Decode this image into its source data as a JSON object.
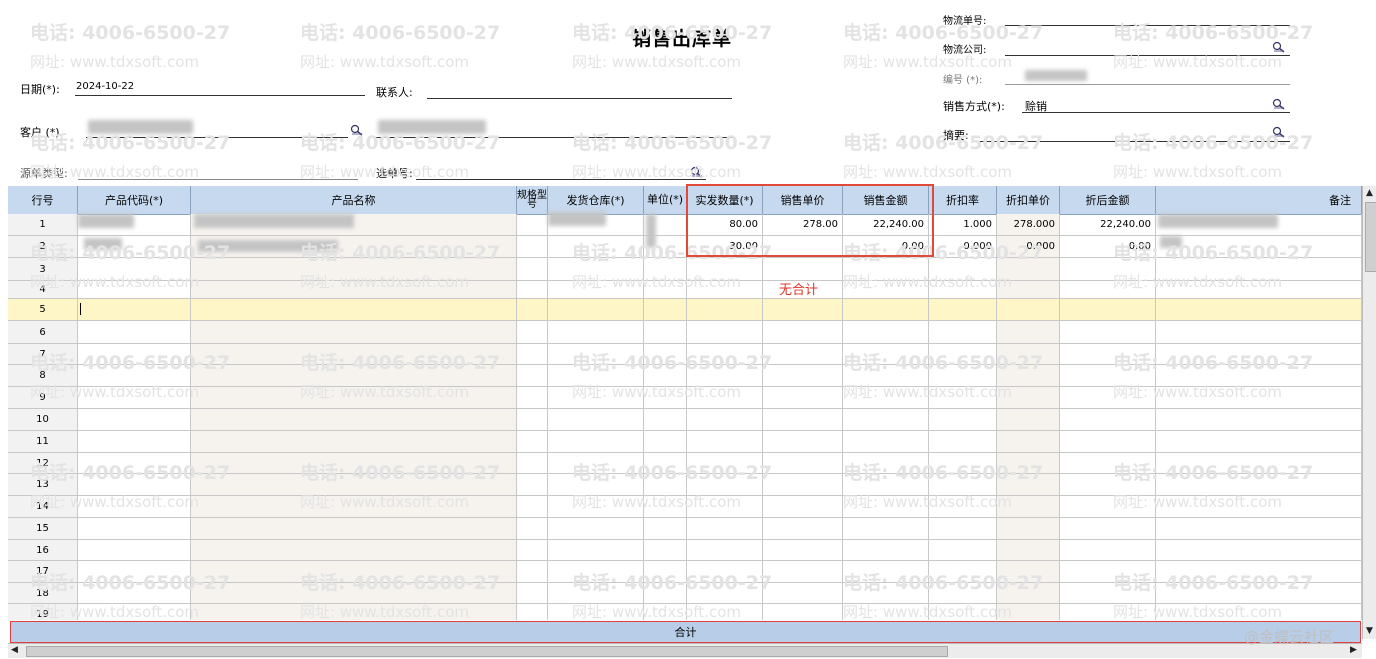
{
  "form": {
    "title": "销售出库单",
    "date_label": "日期(*):",
    "date_value": "2024-10-22",
    "contact_label": "联系人:",
    "customer_label": "客户  (*)",
    "source_type_label": "源单类型:",
    "select_no_label": "选单号:",
    "logistics_no_label": "物流单号:",
    "logistics_company_label": "物流公司:",
    "code_label": "编号   (*):",
    "sale_method_label": "销售方式(*):",
    "sale_method_value": "赊销",
    "summary_label": "摘要:"
  },
  "watermark": {
    "phone": "电话: 4006-6500-27",
    "site": "网址: www.tdxsoft.com"
  },
  "table": {
    "headers": [
      "行号",
      "产品代码(*)",
      "产品名称",
      "规格型号",
      "发货仓库(*)",
      "单位(*)",
      "实发数量(*)",
      "销售单价",
      "销售金额",
      "折扣率",
      "折扣单价",
      "折后金额",
      "备注"
    ],
    "row_numbers": [
      "1",
      "2",
      "3",
      "4",
      "5",
      "6",
      "7",
      "8",
      "9",
      "10",
      "11",
      "12",
      "13",
      "14",
      "15",
      "16",
      "17",
      "18",
      "19"
    ],
    "rows": [
      {
        "qty": "80.00",
        "price": "278.00",
        "amount": "22,240.00",
        "discount_rate": "1.000",
        "discount_price": "278.000",
        "after_amount": "22,240.00"
      },
      {
        "qty": "30.00",
        "price": "",
        "amount": "0.00",
        "discount_rate": "0.000",
        "discount_price": "0.000",
        "after_amount": "0.00"
      }
    ],
    "total_label": "合计"
  },
  "annotation": {
    "note": "无合计"
  },
  "corner_watermark": "@金蝶云社区",
  "colors": {
    "header_bg": "#c7d9ee",
    "active_row_bg": "#fff6c8",
    "highlight_border": "#e04a3a"
  }
}
